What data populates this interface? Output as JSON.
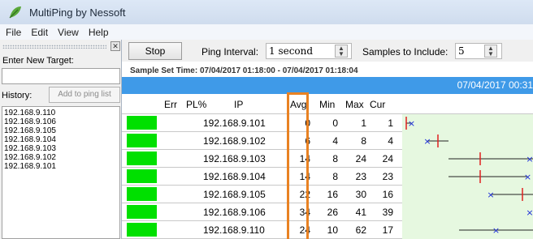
{
  "app": {
    "title": "MultiPing by Nessoft",
    "icon": "leaf-icon"
  },
  "menu": [
    "File",
    "Edit",
    "View",
    "Help"
  ],
  "left_panel": {
    "enter_label": "Enter New Target:",
    "target_value": "",
    "history_label": "History:",
    "add_button": "Add to ping list",
    "history": [
      "192.168.9.110",
      "192.168.9.106",
      "192.168.9.105",
      "192.168.9.104",
      "192.168.9.103",
      "192.168.9.102",
      "192.168.9.101"
    ]
  },
  "toolbar": {
    "stop_label": "Stop",
    "ping_interval_label": "Ping Interval:",
    "ping_interval_value": "1 second",
    "samples_label": "Samples to Include:",
    "samples_value": "5"
  },
  "sample_set": "Sample Set Time: 07/04/2017 01:18:00 - 07/04/2017 01:18:04",
  "timeline_label": "07/04/2017 00:31",
  "columns": [
    "Err",
    "PL%",
    "IP",
    "Avg",
    "Min",
    "Max",
    "Cur"
  ],
  "rows": [
    {
      "err": "",
      "pl": "",
      "ip": "192.168.9.101",
      "avg": "0",
      "min": "0",
      "max": "1",
      "cur": "1",
      "status_color": "#00e000"
    },
    {
      "err": "",
      "pl": "",
      "ip": "192.168.9.102",
      "avg": "6",
      "min": "4",
      "max": "8",
      "cur": "4",
      "status_color": "#00e000"
    },
    {
      "err": "",
      "pl": "",
      "ip": "192.168.9.103",
      "avg": "14",
      "min": "8",
      "max": "24",
      "cur": "24",
      "status_color": "#00e000"
    },
    {
      "err": "",
      "pl": "",
      "ip": "192.168.9.104",
      "avg": "14",
      "min": "8",
      "max": "23",
      "cur": "23",
      "status_color": "#00e000"
    },
    {
      "err": "",
      "pl": "",
      "ip": "192.168.9.105",
      "avg": "22",
      "min": "16",
      "max": "30",
      "cur": "16",
      "status_color": "#00e000"
    },
    {
      "err": "",
      "pl": "",
      "ip": "192.168.9.106",
      "avg": "34",
      "min": "26",
      "max": "41",
      "cur": "39",
      "status_color": "#00e000"
    },
    {
      "err": "",
      "pl": "",
      "ip": "192.168.9.110",
      "avg": "24",
      "min": "10",
      "max": "62",
      "cur": "17",
      "status_color": "#00e000"
    }
  ],
  "colors": {
    "accent_blue": "#3f9ae8",
    "status_green": "#00e000",
    "graph_bg": "#e6f8e0",
    "highlight_orange": "#e98223",
    "marker_red": "#e02020",
    "marker_blue": "#1a2bd8"
  }
}
